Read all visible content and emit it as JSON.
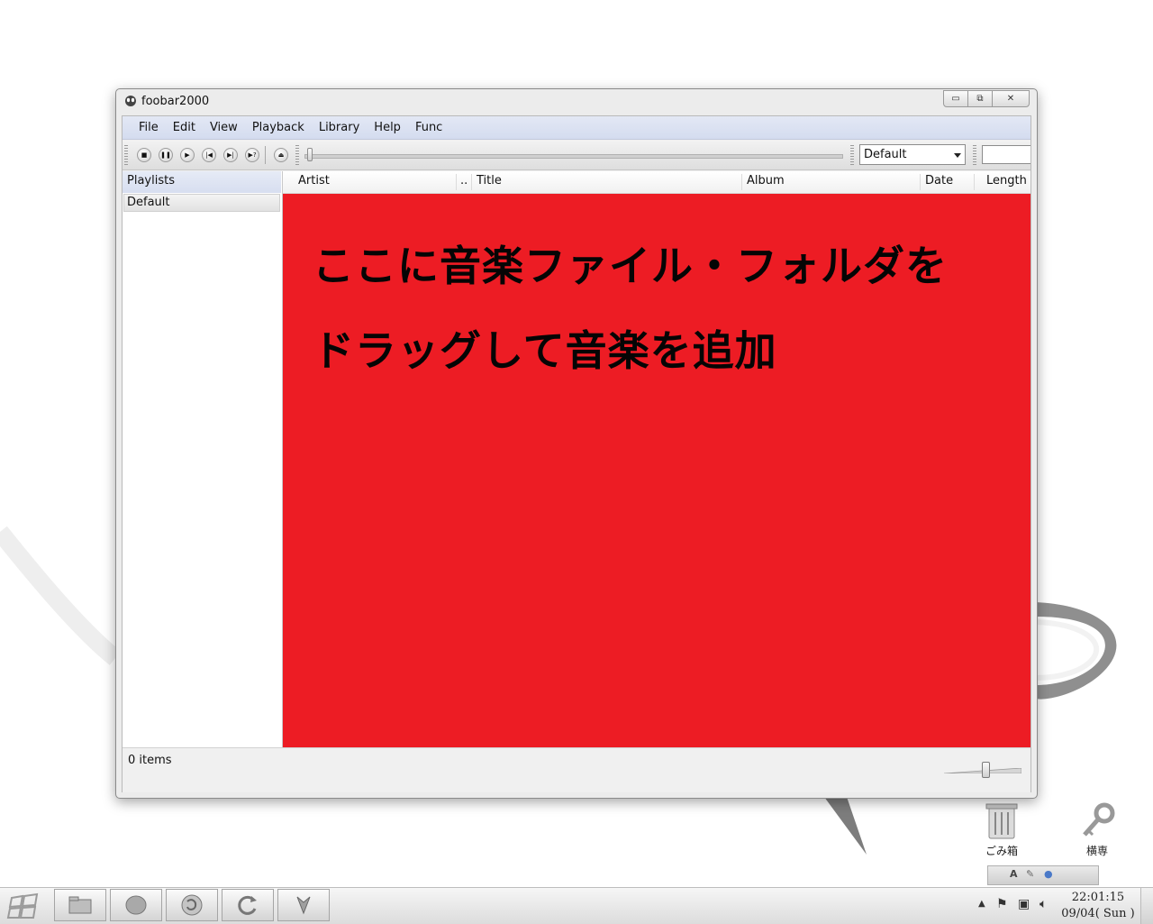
{
  "window": {
    "title": "foobar2000",
    "controls": [
      "minimize",
      "maximize",
      "close"
    ]
  },
  "menu": [
    "File",
    "Edit",
    "View",
    "Playback",
    "Library",
    "Help",
    "Func"
  ],
  "toolbar": {
    "buttons": [
      "stop-icon",
      "pause-icon",
      "play-icon",
      "previous-icon",
      "next-icon",
      "random-icon",
      "eject-icon"
    ],
    "playlist_selector": "Default"
  },
  "playlists_panel": {
    "header": "Playlists",
    "items": [
      "Default"
    ]
  },
  "columns": {
    "artist": "Artist",
    "dots": "..",
    "title": "Title",
    "album": "Album",
    "date": "Date",
    "length": "Length"
  },
  "overlay": {
    "line1": "ここに音楽ファイル・フォルダを",
    "line2": "ドラッグして音楽を追加",
    "background_color": "#ed1c24"
  },
  "status": {
    "items_text": "0 items"
  },
  "volume": {
    "level": 0.53
  },
  "desktop_icons": {
    "trash": "ごみ箱",
    "other": "横専"
  },
  "taskbar": {
    "time": "22:01:15",
    "date": "09/04( Sun )"
  }
}
